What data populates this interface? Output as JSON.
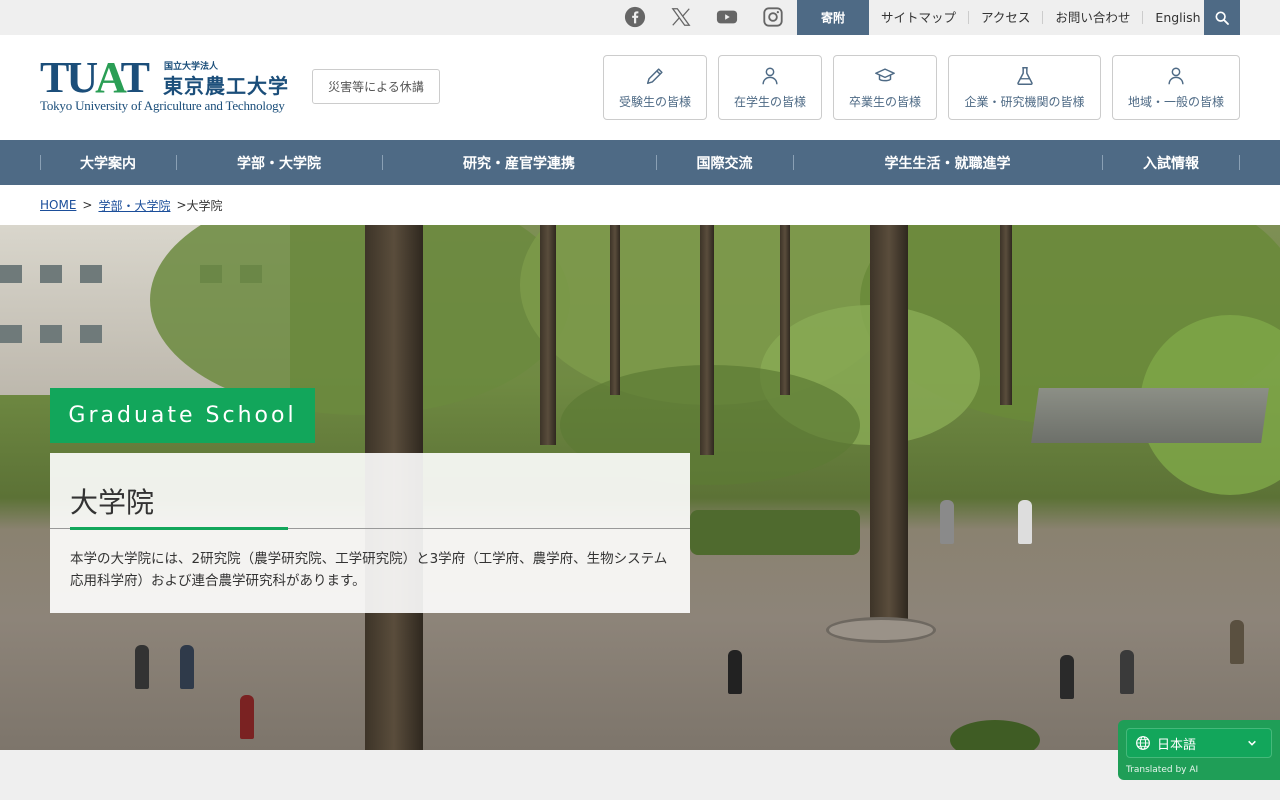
{
  "utility": {
    "social": [
      "facebook-icon",
      "x-icon",
      "youtube-icon",
      "instagram-icon"
    ],
    "donate": "寄附",
    "links": [
      "サイトマップ",
      "アクセス",
      "お問い合わせ",
      "English"
    ]
  },
  "header": {
    "logo_mark": "TUAT",
    "logo_small": "国立大学法人",
    "logo_jp": "東京農工大学",
    "logo_en": "Tokyo University of Agriculture and Technology",
    "disaster_button": "災害等による休講",
    "audiences": [
      {
        "label": "受験生の皆様",
        "icon": "pencil-icon"
      },
      {
        "label": "在学生の皆様",
        "icon": "person-icon"
      },
      {
        "label": "卒業生の皆様",
        "icon": "graduation-cap-icon"
      },
      {
        "label": "企業・研究機関の皆様",
        "icon": "flask-icon"
      },
      {
        "label": "地域・一般の皆様",
        "icon": "community-person-icon"
      }
    ]
  },
  "gnav": [
    "大学案内",
    "学部・大学院",
    "研究・産官学連携",
    "国際交流",
    "学生生活・就職進学",
    "入試情報"
  ],
  "breadcrumb": {
    "home": "HOME",
    "parent": "学部・大学院",
    "current": "大学院",
    "separator": ">"
  },
  "hero": {
    "label": "Graduate School",
    "title": "大学院",
    "description": "本学の大学院には、2研究院（農学研究院、工学研究院）と3学府（工学府、農学府、生物システム応用科学府）および連合農学研究科があります。"
  },
  "language_widget": {
    "selected": "日本語",
    "note": "Translated by AI"
  },
  "colors": {
    "nav": "#4e6a85",
    "accent_green": "#12a65b",
    "brand_blue": "#1b4e7a"
  }
}
